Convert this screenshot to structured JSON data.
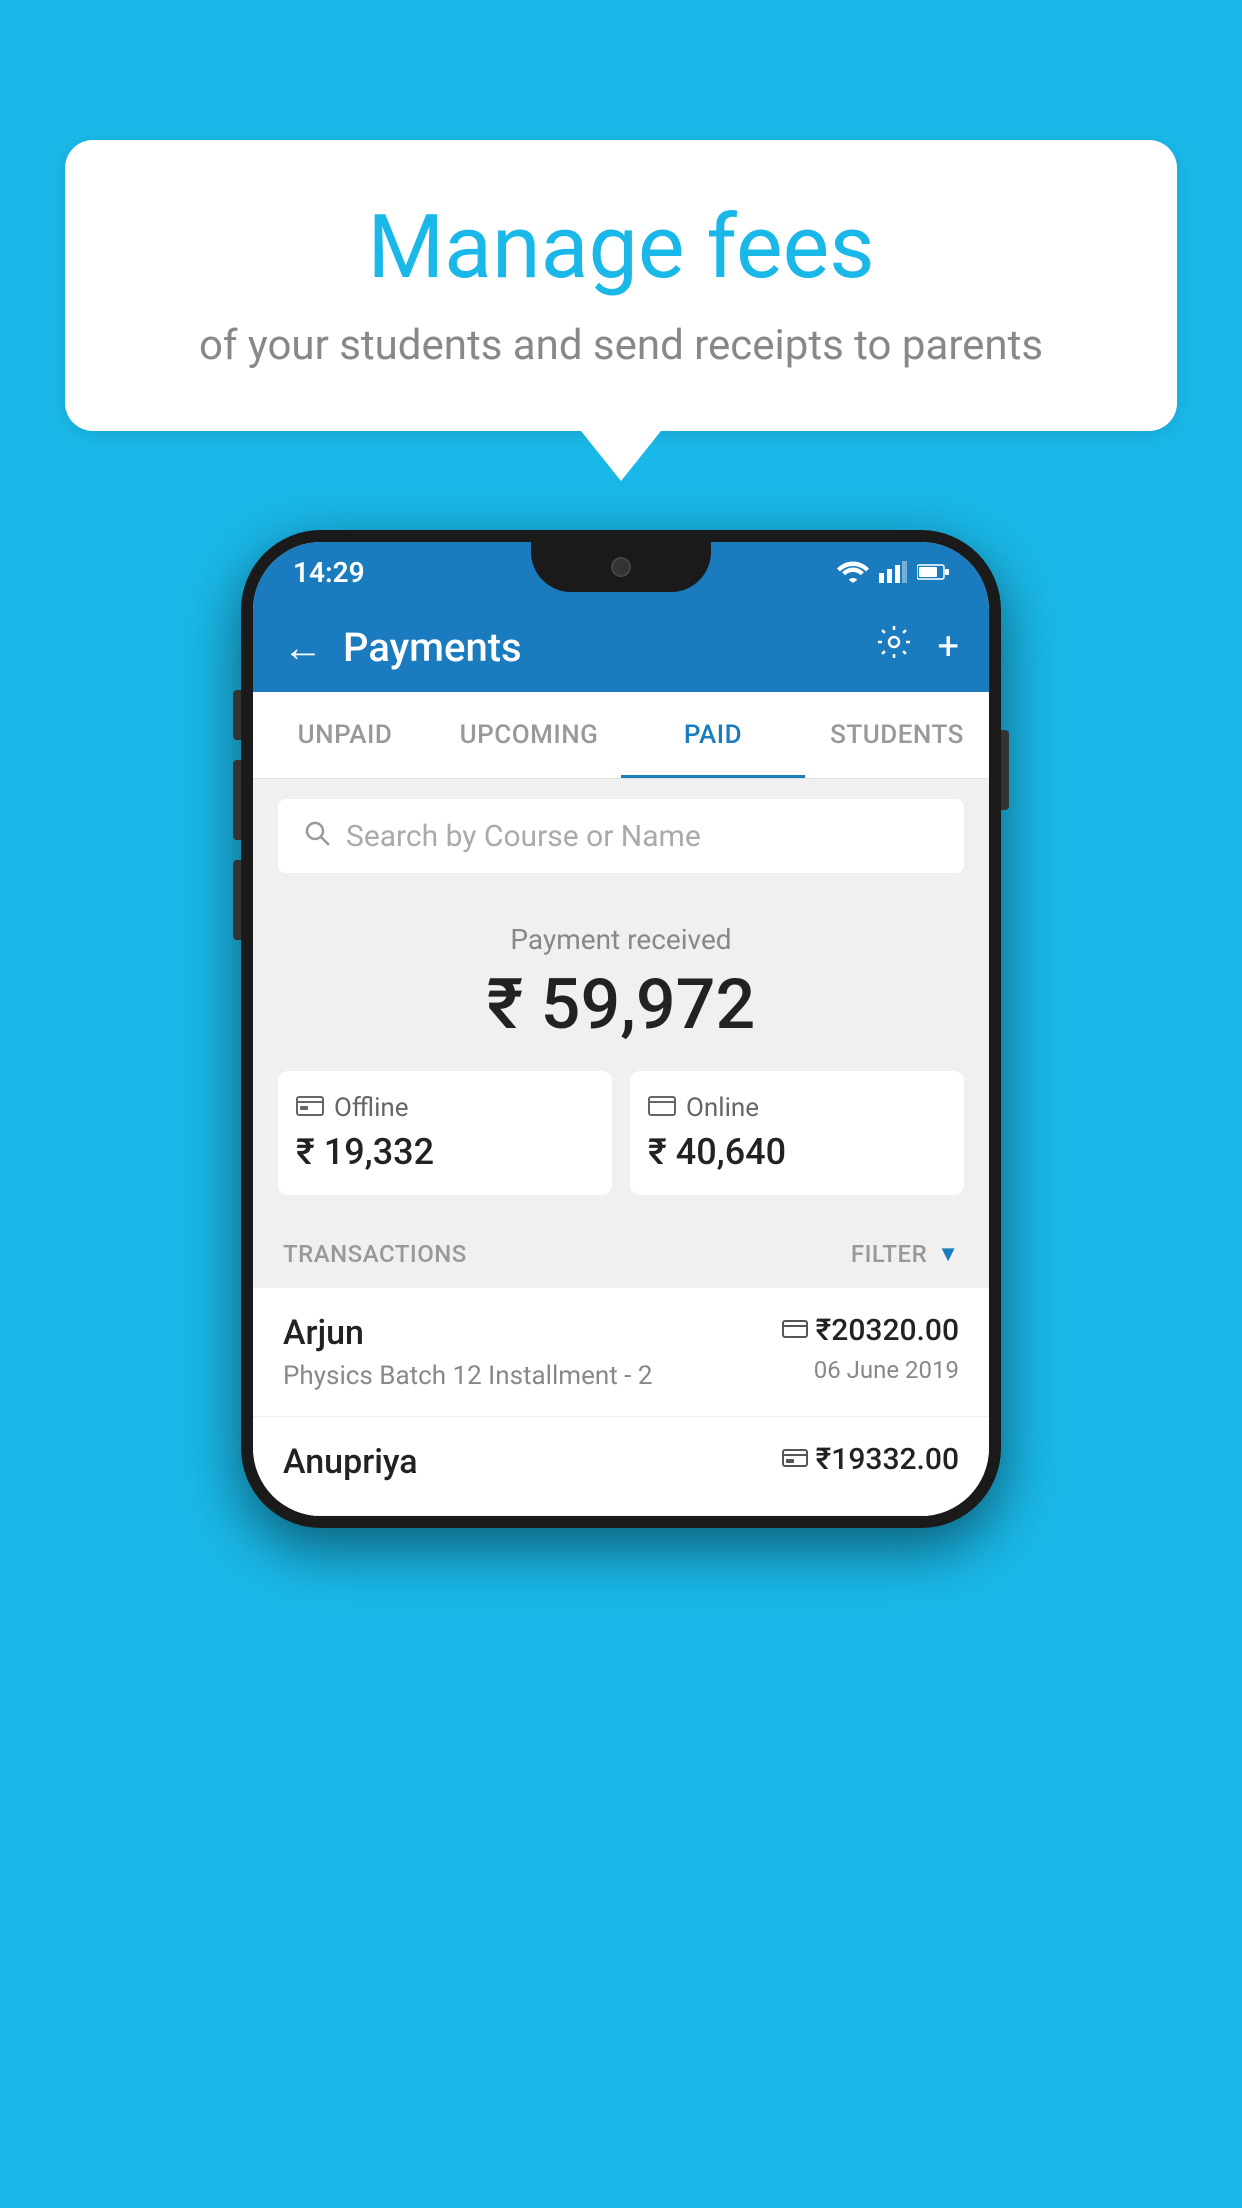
{
  "background_color": "#1ab8e8",
  "speech_bubble": {
    "title": "Manage fees",
    "subtitle": "of your students and send receipts to parents"
  },
  "status_bar": {
    "time": "14:29",
    "icons": [
      "wifi",
      "signal",
      "battery"
    ]
  },
  "header": {
    "title": "Payments",
    "back_icon": "←",
    "settings_icon": "⚙",
    "add_icon": "+"
  },
  "tabs": [
    {
      "label": "UNPAID",
      "active": false
    },
    {
      "label": "UPCOMING",
      "active": false
    },
    {
      "label": "PAID",
      "active": true
    },
    {
      "label": "STUDENTS",
      "active": false
    }
  ],
  "search": {
    "placeholder": "Search by Course or Name"
  },
  "payment_summary": {
    "label": "Payment received",
    "amount": "₹ 59,972",
    "offline": {
      "type": "Offline",
      "amount": "₹ 19,332"
    },
    "online": {
      "type": "Online",
      "amount": "₹ 40,640"
    }
  },
  "transactions": {
    "label": "TRANSACTIONS",
    "filter_label": "FILTER",
    "rows": [
      {
        "name": "Arjun",
        "details": "Physics Batch 12 Installment - 2",
        "amount": "₹20320.00",
        "date": "06 June 2019",
        "payment_icon": "card"
      },
      {
        "name": "Anupriya",
        "details": "",
        "amount": "₹19332.00",
        "date": "",
        "payment_icon": "cash"
      }
    ]
  }
}
